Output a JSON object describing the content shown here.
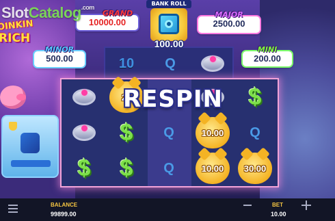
{
  "watermark": {
    "slot": "Slot",
    "catalog": "Catalog",
    "domain": ".com"
  },
  "logo": {
    "line1": "OINKIN",
    "line2": "RICH"
  },
  "jackpots": {
    "grand": {
      "title": "GRAND",
      "value": "10000.00"
    },
    "major": {
      "title": "MAJOR",
      "value": "2500.00"
    },
    "minor": {
      "title": "MINOR",
      "value": "500.00"
    },
    "mini": {
      "title": "MINI",
      "value": "200.00"
    }
  },
  "bank_roll": {
    "title": "BANK ROLL",
    "value": "100.00"
  },
  "feature_banner": "RESPIN",
  "extension_row": [
    "10",
    "Q",
    "ring"
  ],
  "reels": [
    [
      "ring",
      "ring",
      "dollar"
    ],
    [
      "coin",
      "dollar",
      "dollar"
    ],
    [
      "empty",
      "Q",
      "Q"
    ],
    [
      "ring",
      "coin",
      "coin"
    ],
    [
      "dollar",
      "Q",
      "coin"
    ]
  ],
  "coin_values": {
    "col1_row0": "20",
    "col3_row1": "10.00",
    "col3_row2": "10.00",
    "col4_row2": "30.00"
  },
  "bottom_bar": {
    "balance_label": "BALANCE",
    "balance_value": "99899.00",
    "bet_label": "BET",
    "bet_value": "10.00"
  },
  "colors": {
    "frame_glow": "#f2a3d8",
    "label_gold": "#f5c542",
    "dollar_green": "#7de04a"
  }
}
